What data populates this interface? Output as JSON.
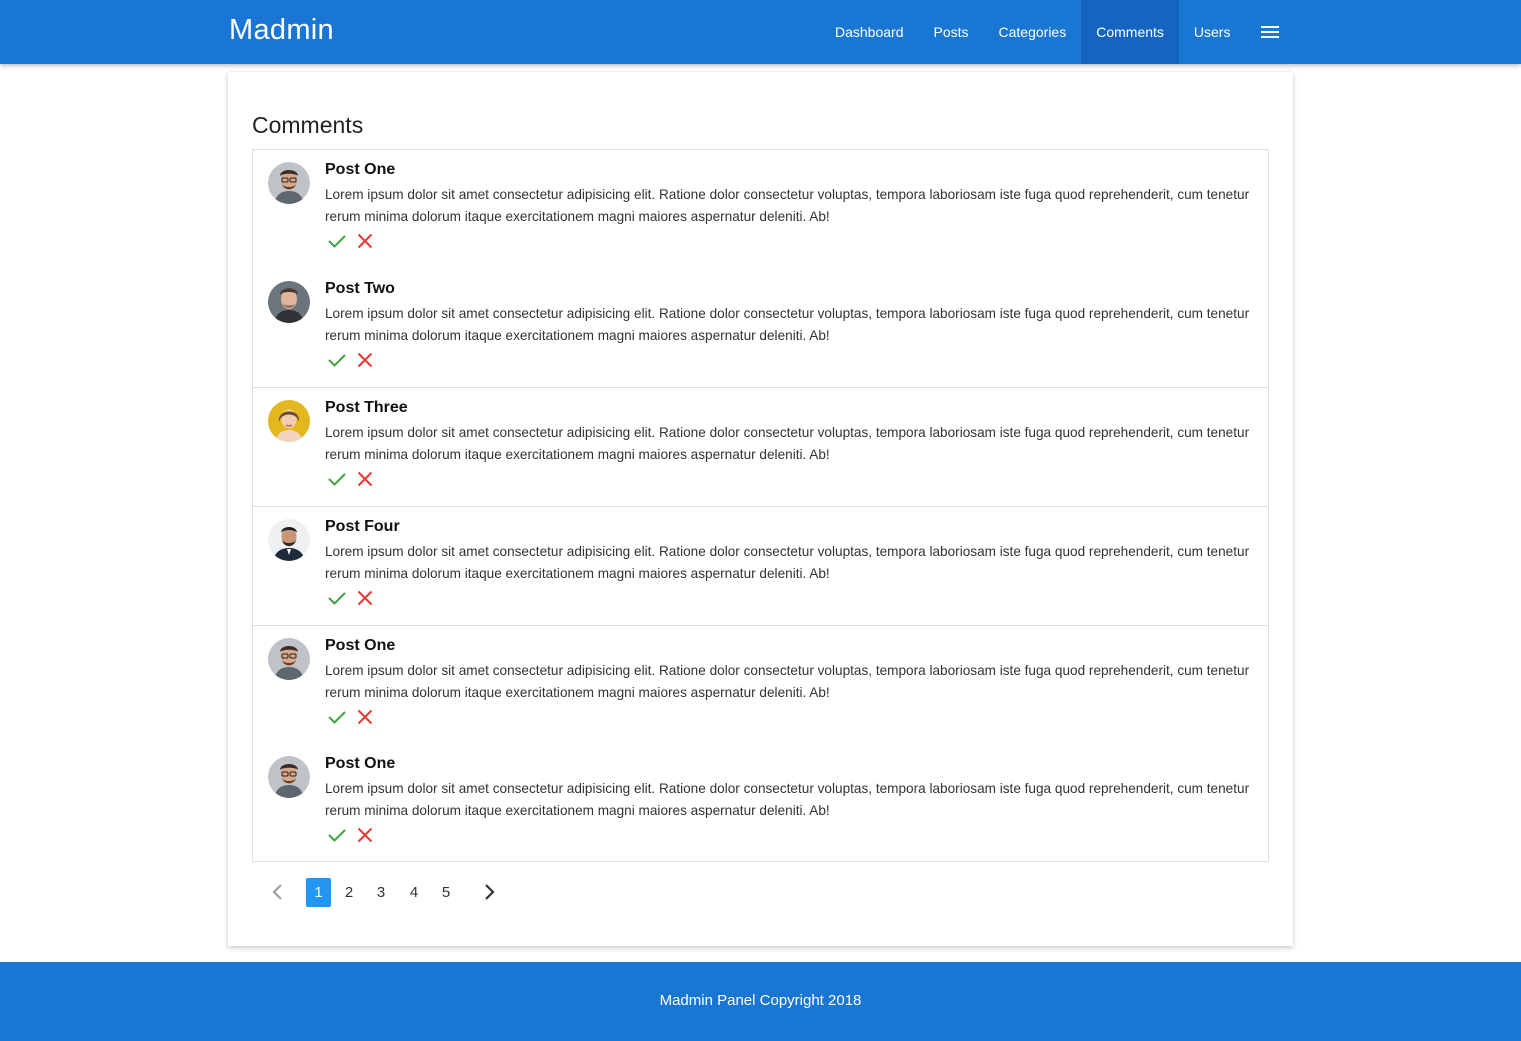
{
  "navbar": {
    "brand": "Madmin",
    "links": [
      "Dashboard",
      "Posts",
      "Categories",
      "Comments",
      "Users"
    ],
    "active_link": "Comments",
    "menu_icon": "hamburger-menu-icon"
  },
  "page": {
    "title": "Comments"
  },
  "comments": [
    {
      "title": "Post One",
      "text": "Lorem ipsum dolor sit amet consectetur adipisicing elit. Ratione dolor consectetur voluptas, tempora laboriosam iste fuga quod reprehenderit, cum tenetur rerum minima dolorum itaque exercitationem magni maiores aspernatur deleniti. Ab!"
    },
    {
      "title": "Post Two",
      "text": "Lorem ipsum dolor sit amet consectetur adipisicing elit. Ratione dolor consectetur voluptas, tempora laboriosam iste fuga quod reprehenderit, cum tenetur rerum minima dolorum itaque exercitationem magni maiores aspernatur deleniti. Ab!"
    },
    {
      "title": "Post Three",
      "text": "Lorem ipsum dolor sit amet consectetur adipisicing elit. Ratione dolor consectetur voluptas, tempora laboriosam iste fuga quod reprehenderit, cum tenetur rerum minima dolorum itaque exercitationem magni maiores aspernatur deleniti. Ab!"
    },
    {
      "title": "Post Four",
      "text": "Lorem ipsum dolor sit amet consectetur adipisicing elit. Ratione dolor consectetur voluptas, tempora laboriosam iste fuga quod reprehenderit, cum tenetur rerum minima dolorum itaque exercitationem magni maiores aspernatur deleniti. Ab!"
    },
    {
      "title": "Post One",
      "text": "Lorem ipsum dolor sit amet consectetur adipisicing elit. Ratione dolor consectetur voluptas, tempora laboriosam iste fuga quod reprehenderit, cum tenetur rerum minima dolorum itaque exercitationem magni maiores aspernatur deleniti. Ab!"
    },
    {
      "title": "Post One",
      "text": "Lorem ipsum dolor sit amet consectetur adipisicing elit. Ratione dolor consectetur voluptas, tempora laboriosam iste fuga quod reprehenderit, cum tenetur rerum minima dolorum itaque exercitationem magni maiores aspernatur deleniti. Ab!"
    }
  ],
  "actions": {
    "approve_icon": "check-icon",
    "reject_icon": "close-icon"
  },
  "pagination": {
    "pages": [
      "1",
      "2",
      "3",
      "4",
      "5"
    ],
    "current": "1",
    "prev_icon": "chevron-left-icon",
    "next_icon": "chevron-right-icon"
  },
  "footer": {
    "text": "Madmin Panel Copyright 2018"
  },
  "colors": {
    "primary": "#1976d2",
    "active_nav": "#1565c0",
    "active_page": "#2196f3",
    "approve": "#43a047",
    "reject": "#e53935"
  }
}
